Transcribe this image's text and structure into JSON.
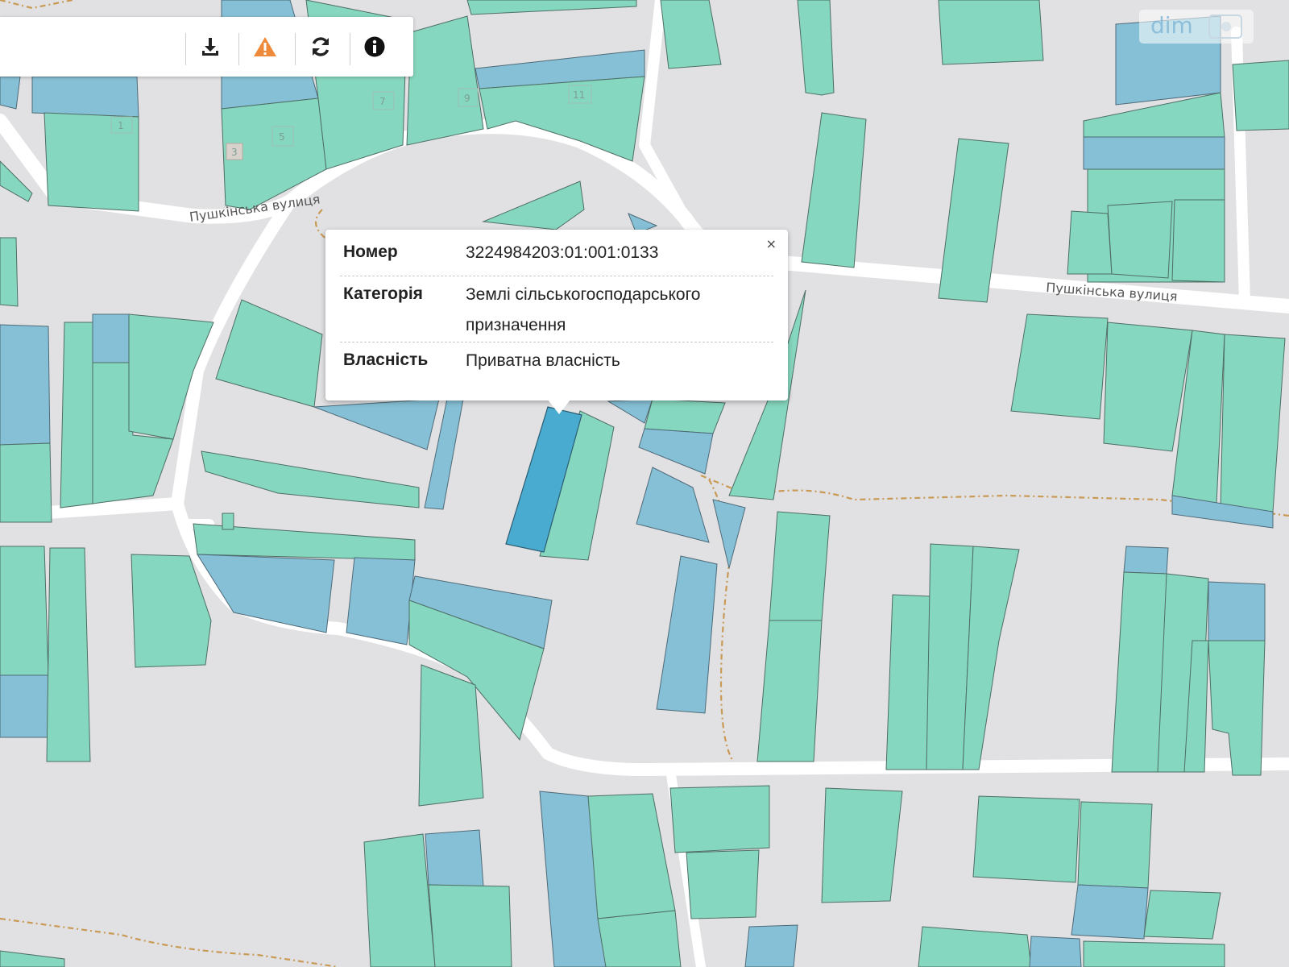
{
  "map": {
    "street_labels": [
      "Пушкінська вулиця",
      "Пушкінська вулиця"
    ],
    "house_numbers": [
      "1",
      "3",
      "5",
      "7",
      "9",
      "11"
    ],
    "colors": {
      "background": "#e1e1e3",
      "parcel_green": "#86d7bf",
      "parcel_blue": "#86c0d6",
      "parcel_selected": "#4aabd0",
      "road": "#ffffff",
      "trail": "#c99a55"
    }
  },
  "toolbar": {
    "buttons": [
      {
        "name": "download-icon"
      },
      {
        "name": "warning-icon",
        "color": "#ef8a3a"
      },
      {
        "name": "refresh-icon"
      },
      {
        "name": "info-icon"
      }
    ]
  },
  "popup": {
    "close_label": "×",
    "rows": [
      {
        "key": "Номер",
        "value": "3224984203:01:001:0133"
      },
      {
        "key": "Категорія",
        "value_line1": "Землі сільськогосподарського",
        "value_line2": "призначення"
      },
      {
        "key": "Власність",
        "value": "Приватна власність"
      }
    ]
  },
  "watermark": {
    "text": "dim"
  }
}
